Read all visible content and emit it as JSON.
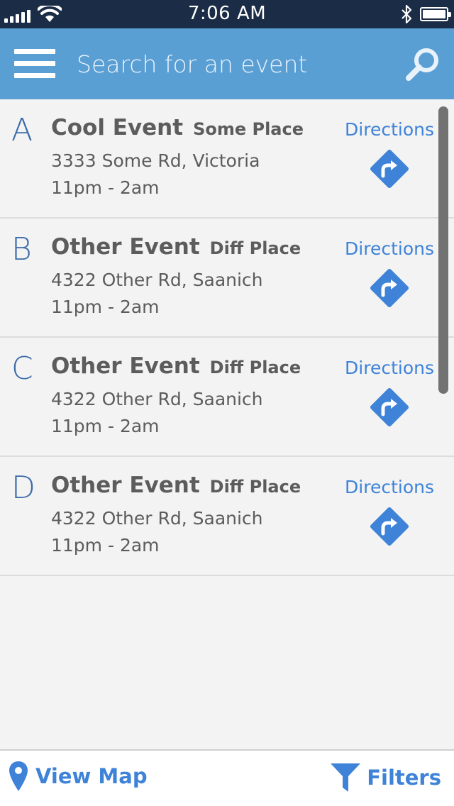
{
  "status_bar": {
    "time": "7:06 AM",
    "icons": [
      "signal-icon",
      "wifi-icon",
      "bluetooth-icon",
      "battery-icon"
    ]
  },
  "header": {
    "search_placeholder": "Search for an event",
    "search_value": "",
    "menu_icon": "hamburger-menu-icon",
    "search_icon": "magnifier-icon",
    "background_color": "#5a9fd4"
  },
  "events": [
    {
      "letter": "A",
      "name": "Cool Event",
      "place": "Some Place",
      "address": "3333 Some Rd, Victoria",
      "time": "11pm - 2am",
      "directions_label": "Directions"
    },
    {
      "letter": "B",
      "name": "Other Event",
      "place": "Diff Place",
      "address": "4322 Other Rd, Saanich",
      "time": "11pm - 2am",
      "directions_label": "Directions"
    },
    {
      "letter": "C",
      "name": "Other Event",
      "place": "Diff Place",
      "address": "4322 Other Rd, Saanich",
      "time": "11pm - 2am",
      "directions_label": "Directions"
    },
    {
      "letter": "D",
      "name": "Other Event",
      "place": "Diff Place",
      "address": "4322 Other Rd, Saanich",
      "time": "11pm - 2am",
      "directions_label": "Directions"
    }
  ],
  "bottom_bar": {
    "view_map_label": "View Map",
    "filters_label": "Filters"
  },
  "colors": {
    "accent": "#3e83d8",
    "status_bar": "#1b2c46",
    "letter": "#3b6aa8",
    "text": "#5c5c5c"
  }
}
